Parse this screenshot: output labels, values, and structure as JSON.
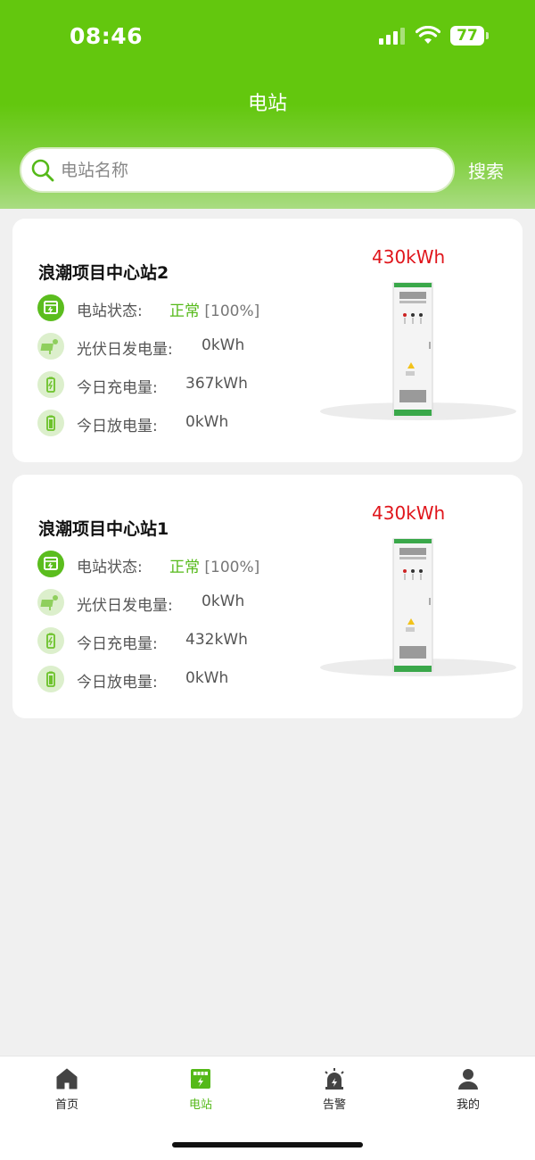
{
  "status_bar": {
    "time": "08:46",
    "battery": "77"
  },
  "header": {
    "title": "电站"
  },
  "search": {
    "placeholder": "电站名称",
    "value": "",
    "button_label": "搜索"
  },
  "stations": [
    {
      "name": "浪潮项目中心站2",
      "capacity": "430kWh",
      "status_label": "电站状态:",
      "status_value": "正常",
      "status_percent": "[100%]",
      "pv_label": "光伏日发电量:",
      "pv_value": "0kWh",
      "charge_label": "今日充电量:",
      "charge_value": "367kWh",
      "discharge_label": "今日放电量:",
      "discharge_value": "0kWh"
    },
    {
      "name": "浪潮项目中心站1",
      "capacity": "430kWh",
      "status_label": "电站状态:",
      "status_value": "正常",
      "status_percent": "[100%]",
      "pv_label": "光伏日发电量:",
      "pv_value": "0kWh",
      "charge_label": "今日充电量:",
      "charge_value": "432kWh",
      "discharge_label": "今日放电量:",
      "discharge_value": "0kWh"
    }
  ],
  "tabbar": {
    "items": [
      {
        "label": "首页",
        "icon": "home-icon"
      },
      {
        "label": "电站",
        "icon": "station-icon"
      },
      {
        "label": "告警",
        "icon": "alarm-icon"
      },
      {
        "label": "我的",
        "icon": "user-icon"
      }
    ],
    "active_index": 1
  },
  "colors": {
    "brand_green": "#63c70e",
    "status_ok": "#55b919",
    "capacity_red": "#e0151b"
  }
}
